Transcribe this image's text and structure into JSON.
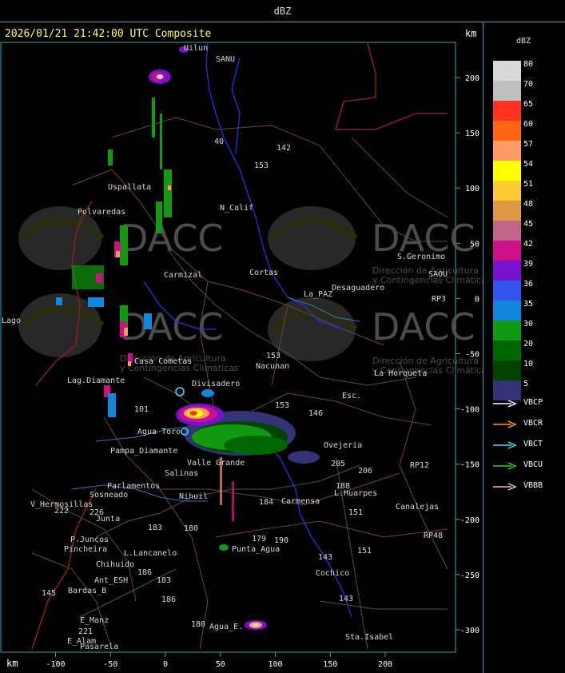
{
  "title": "dBZ",
  "timestamp_label": "2026/01/21 21:42:00 UTC Composite",
  "units": {
    "top": "km",
    "bottom": "km"
  },
  "axes": {
    "x_ticks": [
      -100,
      -50,
      0,
      50,
      100,
      150,
      200
    ],
    "y_ticks": [
      200,
      150,
      100,
      50,
      0,
      -50,
      -100,
      -150,
      -200,
      -250,
      -300
    ]
  },
  "legend": {
    "title": "dBZ",
    "scale": [
      {
        "value": "80",
        "color": "#d9d9d9"
      },
      {
        "value": "70",
        "color": "#bfbfbf"
      },
      {
        "value": "65",
        "color": "#ff3322"
      },
      {
        "value": "60",
        "color": "#ff6611"
      },
      {
        "value": "57",
        "color": "#ff9966"
      },
      {
        "value": "54",
        "color": "#ffff00"
      },
      {
        "value": "51",
        "color": "#ffcc33"
      },
      {
        "value": "48",
        "color": "#dd9944"
      },
      {
        "value": "45",
        "color": "#c06688"
      },
      {
        "value": "42",
        "color": "#cc1188"
      },
      {
        "value": "39",
        "color": "#7711cc"
      },
      {
        "value": "36",
        "color": "#3355ee"
      },
      {
        "value": "35",
        "color": "#1188dd"
      },
      {
        "value": "30",
        "color": "#119911"
      },
      {
        "value": "20",
        "color": "#006600"
      },
      {
        "value": "10",
        "color": "#004400"
      },
      {
        "value": "5",
        "color": "#333377"
      }
    ],
    "radars": [
      {
        "name": "VBCP",
        "color": "#ffffff"
      },
      {
        "name": "VBCR",
        "color": "#ff9944"
      },
      {
        "name": "VBCT",
        "color": "#44ddff"
      },
      {
        "name": "VBCU",
        "color": "#33cc33"
      },
      {
        "name": "VBBB",
        "color": "#ffbbbb"
      }
    ]
  },
  "watermark": {
    "brand": "DACC",
    "line1": "Dirección de Agricultura",
    "line2": "y Contingencias Climáticas"
  },
  "places": [
    {
      "name": "Uilun"
    },
    {
      "name": "SANU"
    },
    {
      "name": "Uspallata"
    },
    {
      "name": "Polvaredas"
    },
    {
      "name": "N_Calif"
    },
    {
      "name": "Carmizal"
    },
    {
      "name": "Cortas"
    },
    {
      "name": "S.Geronimo"
    },
    {
      "name": "SAOU"
    },
    {
      "name": "Desaguadero"
    },
    {
      "name": "La_PAZ"
    },
    {
      "name": "Nacunan"
    },
    {
      "name": "La Horqueta"
    },
    {
      "name": "Casa Cometas"
    },
    {
      "name": "Lag.Diamante"
    },
    {
      "name": "Divisadero"
    },
    {
      "name": "Esc."
    },
    {
      "name": "Agua Toro"
    },
    {
      "name": "Pampa_Diamante"
    },
    {
      "name": "Ovejeria"
    },
    {
      "name": "Valle Grande"
    },
    {
      "name": "Salinas"
    },
    {
      "name": "Parlamentos"
    },
    {
      "name": "Sosneado"
    },
    {
      "name": "Nihuil"
    },
    {
      "name": "Carmensa"
    },
    {
      "name": "L.Huarpes"
    },
    {
      "name": "Canalejas"
    },
    {
      "name": "V_Hermosillas"
    },
    {
      "name": "Junta"
    },
    {
      "name": "P.Juncos"
    },
    {
      "name": "Pincheira"
    },
    {
      "name": "L.Lancanelo"
    },
    {
      "name": "Chihuido"
    },
    {
      "name": "Ant_ESH"
    },
    {
      "name": "Bardas_B"
    },
    {
      "name": "Punta_Agua"
    },
    {
      "name": "Cochico"
    },
    {
      "name": "E_Manz"
    },
    {
      "name": "Agua_E."
    },
    {
      "name": "E_Alam"
    },
    {
      "name": "Pasarela"
    },
    {
      "name": "Sta.Isabel"
    },
    {
      "name": "RP3"
    },
    {
      "name": "RP12"
    },
    {
      "name": "RP48"
    },
    {
      "name": "Lago"
    }
  ],
  "route_numbers": [
    "40",
    "142",
    "153",
    "146",
    "205",
    "206",
    "188",
    "151",
    "143",
    "180",
    "184",
    "179",
    "190",
    "183",
    "186",
    "145",
    "221",
    "222",
    "226",
    "101",
    "143"
  ]
}
